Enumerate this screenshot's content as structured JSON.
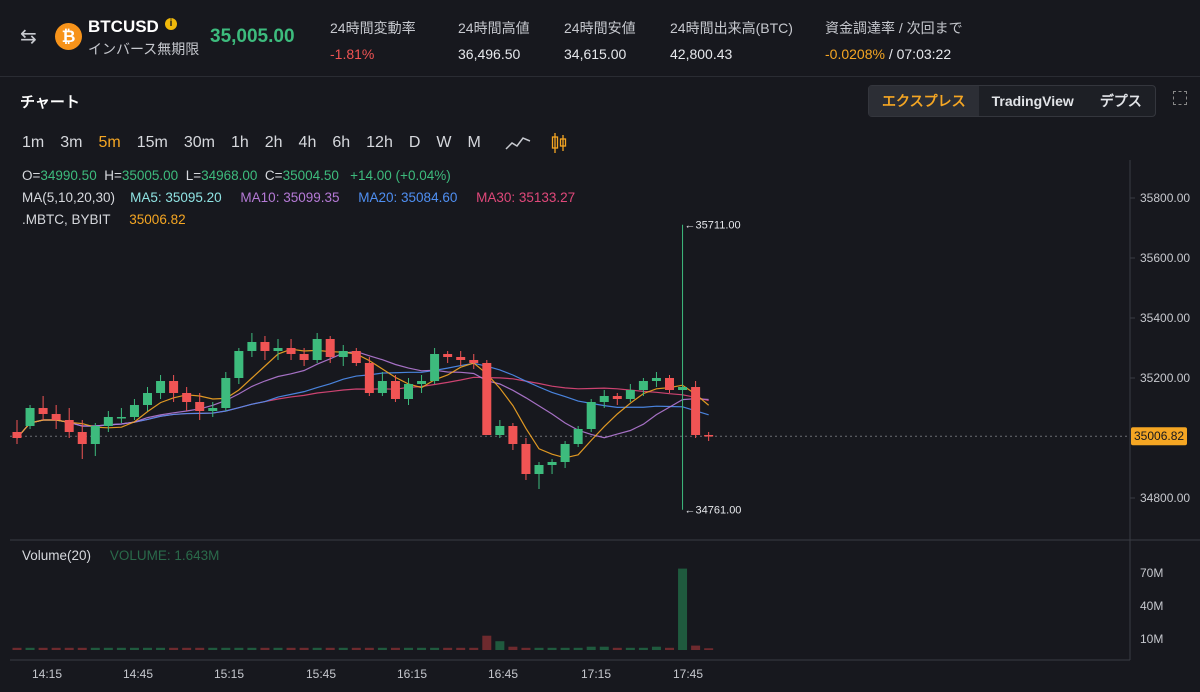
{
  "header": {
    "symbol": "BTCUSD",
    "subtitle": "インバース無期限",
    "last_price": "35,005.00",
    "stats": [
      {
        "label": "24時間変動率",
        "value": "-1.81%",
        "tone": "red"
      },
      {
        "label": "24時間高値",
        "value": "36,496.50",
        "tone": "normal"
      },
      {
        "label": "24時間安値",
        "value": "34,615.00",
        "tone": "normal"
      },
      {
        "label": "24時間出来高(BTC)",
        "value": "42,800.43",
        "tone": "normal"
      },
      {
        "label": "資金調達率 / 次回まで",
        "value": "-0.0208%",
        "value2": " / 07:03:22",
        "tone": "orange"
      }
    ]
  },
  "chart_panel": {
    "title": "チャート",
    "view_tabs": [
      "エクスプレス",
      "TradingView",
      "デプス"
    ],
    "active_view": "エクスプレス",
    "intervals": [
      "1m",
      "3m",
      "5m",
      "15m",
      "30m",
      "1h",
      "2h",
      "4h",
      "6h",
      "12h",
      "D",
      "W",
      "M"
    ],
    "active_interval": "5m"
  },
  "legend": {
    "ohlc": {
      "o_label": "O=",
      "o": "34990.50",
      "h_label": "H=",
      "h": "35005.00",
      "l_label": "L=",
      "l": "34968.00",
      "c_label": "C=",
      "c": "35004.50",
      "change": "+14.00 (+0.04%)"
    },
    "ma_title": "MA(5,10,20,30)",
    "ma": [
      {
        "label": "MA5: 35095.20",
        "color": "#8fe3e3"
      },
      {
        "label": "MA10: 35099.35",
        "color": "#b57ad6"
      },
      {
        "label": "MA20: 35084.60",
        "color": "#4f8ff2"
      },
      {
        "label": "MA30: 35133.27",
        "color": "#e0487a"
      }
    ],
    "index_label": ".MBTC,  BYBIT",
    "index_value": "35006.82",
    "volume_label": "Volume(20)",
    "volume_value": "VOLUME: 1.643M"
  },
  "colors": {
    "up": "#3dbb7d",
    "down": "#f05454",
    "accent": "#f5a623"
  },
  "chart_data": {
    "type": "candlestick",
    "price_axis": {
      "ticks": [
        35800,
        35600,
        35400,
        35200,
        34800
      ],
      "tick_labels": [
        "35800.00",
        "35600.00",
        "35400.00",
        "35200.00",
        "34800.00"
      ],
      "ylim": [
        34720,
        35850
      ]
    },
    "current_price_label": "35006.82",
    "high_marker": "35711.00",
    "low_marker": "34761.00",
    "volume_axis": {
      "ticks": [
        70,
        40,
        10
      ],
      "tick_labels": [
        "70M",
        "40M",
        "10M"
      ]
    },
    "x_labels": [
      "14:15",
      "14:45",
      "15:15",
      "15:45",
      "16:15",
      "16:45",
      "17:15",
      "17:45"
    ],
    "candles": [
      [
        35020,
        35060,
        34980,
        35000
      ],
      [
        35040,
        35110,
        35030,
        35100
      ],
      [
        35100,
        35140,
        35060,
        35080
      ],
      [
        35080,
        35110,
        35030,
        35060
      ],
      [
        35060,
        35100,
        35000,
        35020
      ],
      [
        35020,
        35060,
        34930,
        34980
      ],
      [
        34980,
        35050,
        34940,
        35040
      ],
      [
        35040,
        35090,
        35020,
        35070
      ],
      [
        35070,
        35100,
        35050,
        35070
      ],
      [
        35070,
        35130,
        35060,
        35110
      ],
      [
        35110,
        35170,
        35090,
        35150
      ],
      [
        35150,
        35210,
        35130,
        35190
      ],
      [
        35190,
        35210,
        35120,
        35150
      ],
      [
        35150,
        35170,
        35090,
        35120
      ],
      [
        35120,
        35150,
        35060,
        35090
      ],
      [
        35090,
        35120,
        35070,
        35100
      ],
      [
        35100,
        35220,
        35090,
        35200
      ],
      [
        35200,
        35300,
        35180,
        35290
      ],
      [
        35290,
        35350,
        35270,
        35320
      ],
      [
        35320,
        35340,
        35260,
        35290
      ],
      [
        35290,
        35330,
        35260,
        35300
      ],
      [
        35300,
        35330,
        35260,
        35280
      ],
      [
        35280,
        35300,
        35240,
        35260
      ],
      [
        35260,
        35350,
        35250,
        35330
      ],
      [
        35330,
        35340,
        35250,
        35270
      ],
      [
        35270,
        35310,
        35240,
        35290
      ],
      [
        35290,
        35300,
        35240,
        35250
      ],
      [
        35250,
        35270,
        35140,
        35150
      ],
      [
        35150,
        35220,
        35140,
        35190
      ],
      [
        35190,
        35210,
        35120,
        35130
      ],
      [
        35130,
        35200,
        35110,
        35180
      ],
      [
        35180,
        35210,
        35150,
        35190
      ],
      [
        35190,
        35300,
        35180,
        35280
      ],
      [
        35280,
        35290,
        35250,
        35270
      ],
      [
        35270,
        35290,
        35240,
        35260
      ],
      [
        35260,
        35280,
        35230,
        35250
      ],
      [
        35250,
        35260,
        35010,
        35010
      ],
      [
        35010,
        35060,
        35000,
        35040
      ],
      [
        35040,
        35050,
        34960,
        34980
      ],
      [
        34980,
        35000,
        34860,
        34880
      ],
      [
        34880,
        34920,
        34830,
        34910
      ],
      [
        34910,
        34930,
        34880,
        34920
      ],
      [
        34920,
        34990,
        34900,
        34980
      ],
      [
        34980,
        35040,
        34970,
        35030
      ],
      [
        35030,
        35130,
        35020,
        35120
      ],
      [
        35120,
        35160,
        35100,
        35140
      ],
      [
        35140,
        35150,
        35110,
        35130
      ],
      [
        35130,
        35180,
        35120,
        35160
      ],
      [
        35160,
        35200,
        35140,
        35190
      ],
      [
        35190,
        35220,
        35170,
        35200
      ],
      [
        35200,
        35210,
        35150,
        35160
      ],
      [
        35160,
        35711,
        34761,
        35170
      ],
      [
        35170,
        35190,
        35000,
        35010
      ],
      [
        35010,
        35020,
        34990,
        35006
      ]
    ],
    "volumes_m": [
      2,
      2,
      2,
      2,
      2,
      2,
      2,
      2,
      2,
      2,
      2,
      2,
      2,
      2,
      2,
      2,
      2,
      2,
      2,
      2,
      2,
      2,
      2,
      2,
      2,
      2,
      2,
      2,
      2,
      2,
      2,
      2,
      2,
      2,
      2,
      2,
      13,
      8,
      3,
      2,
      2,
      2,
      2,
      2,
      3,
      3,
      2,
      2,
      2,
      3,
      2,
      74,
      4,
      1.6
    ]
  }
}
